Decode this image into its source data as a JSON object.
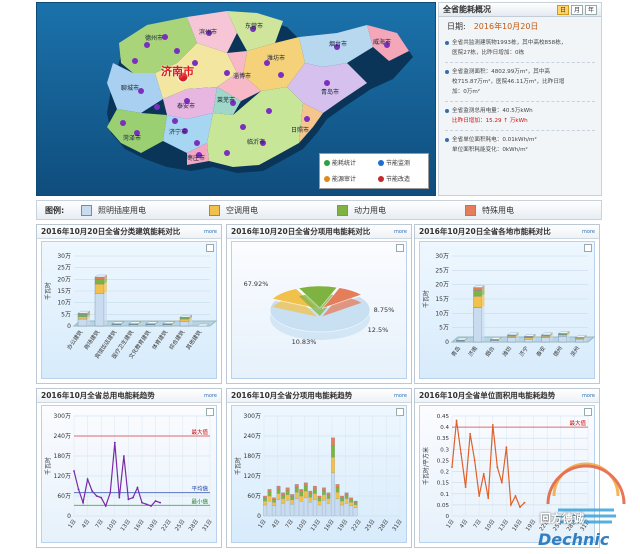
{
  "map": {
    "city_labels": [
      "济南市",
      "德州市",
      "滨州市",
      "东营市",
      "潍坊市",
      "烟台市",
      "威海市",
      "聊城市",
      "泰安市",
      "莱芜市",
      "淄博市",
      "青岛市",
      "日照市",
      "临沂市",
      "济宁市",
      "菏泽市",
      "枣庄市"
    ],
    "legend": [
      {
        "label": "能耗统计",
        "color": "#27a342"
      },
      {
        "label": "节能监测",
        "color": "#1d6fd1"
      },
      {
        "label": "能源审计",
        "color": "#e08a1a"
      },
      {
        "label": "节能改造",
        "color": "#c52a2a"
      }
    ]
  },
  "info": {
    "title": "全省能耗概况",
    "buttons": [
      "日",
      "月",
      "年"
    ],
    "date_label": "日期:",
    "date_value": "2016年10月20日",
    "blocks": [
      [
        "全省共监测建筑物1993栋，其中高校858栋，",
        "医院27栋，比昨日增加：0栋"
      ],
      [
        "全省监测面积：4802.99万m²，其中高",
        "校715.87万m²，医院46.11万m²，比昨日增",
        "加：0万m²"
      ],
      [
        "全省监测总用电量：40.5万kWh",
        "比昨日增加：15.29 ↑ 万kWh"
      ],
      [
        "全省单位面积耗电：0.01kWh/m²",
        "单位面积耗能变化：0kWh/m²"
      ]
    ]
  },
  "category_bar": {
    "title": "图例:",
    "items": [
      {
        "label": "照明插座用电",
        "color": "#c9dcef"
      },
      {
        "label": "空调用电",
        "color": "#f2c14b"
      },
      {
        "label": "动力用电",
        "color": "#7fb341"
      },
      {
        "label": "特殊用电",
        "color": "#e47d5a"
      }
    ]
  },
  "panels": [
    {
      "title": "2016年10月20日全省分类建筑能耗对比",
      "more": "more"
    },
    {
      "title": "2016年10月20日全省分项用电能耗对比",
      "more": "more"
    },
    {
      "title": "2016年10月20日全省各地市能耗对比",
      "more": "more"
    },
    {
      "title": "2016年10月全省总用电能耗趋势",
      "more": "more"
    },
    {
      "title": "2016年10月全省分项用电能耗趋势",
      "more": "more"
    },
    {
      "title": "2016年10月全省单位面积用电能耗趋势",
      "more": "more"
    }
  ],
  "chart_data": [
    {
      "type": "bar",
      "ylabel": "千瓦时",
      "yticks": [
        "30万",
        "25万",
        "20万",
        "15万",
        "10万",
        "5万",
        "0"
      ],
      "categories": [
        "办公建筑",
        "商场建筑",
        "宾馆饭店建筑",
        "医疗卫生建筑",
        "文化教育建筑",
        "体育建筑",
        "综合建筑",
        "其他建筑"
      ],
      "series": [
        {
          "values": [
            3,
            14,
            0.5,
            0.5,
            0.5,
            0.5,
            2,
            0
          ]
        },
        {
          "values": [
            1,
            4,
            0.2,
            0.2,
            0.2,
            0.2,
            1,
            0
          ]
        },
        {
          "values": [
            1,
            2,
            0.2,
            0.2,
            0.2,
            0.2,
            0.5,
            0
          ]
        },
        {
          "values": [
            0.5,
            1,
            0.1,
            0.1,
            0.1,
            0.1,
            0.3,
            0
          ]
        }
      ]
    },
    {
      "type": "pie",
      "slices": [
        {
          "label": "67.92%",
          "value": 67.92,
          "color": "#c9e0f3"
        },
        {
          "label": "10.83%",
          "value": 10.83,
          "color": "#f2c14b"
        },
        {
          "label": "12.5%",
          "value": 12.5,
          "color": "#7fb341"
        },
        {
          "label": "8.75%",
          "value": 8.75,
          "color": "#e47d5a"
        }
      ]
    },
    {
      "type": "bar",
      "ylabel": "千瓦时",
      "yticks": [
        "30万",
        "25万",
        "20万",
        "15万",
        "10万",
        "5万",
        "0"
      ],
      "categories": [
        "青岛",
        "济南",
        "烟台",
        "潍坊",
        "济宁",
        "泰安",
        "德州",
        "滨州"
      ],
      "series": [
        {
          "values": [
            0.3,
            12,
            0.5,
            1.5,
            1,
            1.5,
            2,
            1
          ]
        },
        {
          "values": [
            0.2,
            4,
            0.2,
            0.5,
            0.5,
            0.5,
            0.5,
            0.3
          ]
        },
        {
          "values": [
            0.1,
            2,
            0.1,
            0.3,
            0.3,
            0.3,
            0.3,
            0.2
          ]
        },
        {
          "values": [
            0.1,
            1,
            0.1,
            0.2,
            0.2,
            0.2,
            0.2,
            0.1
          ]
        }
      ]
    },
    {
      "type": "line",
      "ylabel": "千瓦时",
      "yticks": [
        "300万",
        "240万",
        "180万",
        "120万",
        "60万",
        "0"
      ],
      "ylim": [
        0,
        300
      ],
      "xticks": [
        "1日",
        "4日",
        "7日",
        "10日",
        "13日",
        "16日",
        "19日",
        "22日",
        "25日",
        "28日",
        "31日"
      ],
      "max_label": "最大值",
      "avg_label": "平均值",
      "min_label": "最小值",
      "max_value": 240,
      "avg_value": 70,
      "min_value": 32,
      "values": [
        135,
        80,
        40,
        110,
        75,
        60,
        55,
        30,
        70,
        220,
        55,
        180,
        50,
        55,
        85,
        40,
        35,
        30,
        45,
        40
      ]
    },
    {
      "type": "bar",
      "ylabel": "千瓦时",
      "yticks": [
        "300万",
        "240万",
        "180万",
        "120万",
        "60万",
        "0"
      ],
      "ylim": [
        0,
        300
      ],
      "xticks": [
        "1日",
        "4日",
        "7日",
        "10日",
        "13日",
        "16日",
        "19日",
        "22日",
        "25日",
        "28日",
        "31日"
      ],
      "values": [
        60,
        80,
        55,
        90,
        70,
        85,
        65,
        95,
        80,
        100,
        75,
        90,
        60,
        85,
        70,
        235,
        95,
        60,
        70,
        55,
        45
      ]
    },
    {
      "type": "line",
      "ylabel": "千瓦时/平方米",
      "yticks": [
        "0.45",
        "0.4",
        "0.35",
        "0.3",
        "0.25",
        "0.2",
        "0.15",
        "0.1",
        "0.05",
        "0"
      ],
      "ylim": [
        0,
        0.45
      ],
      "xticks": [
        "1日",
        "4日",
        "7日",
        "10日",
        "13日",
        "16日",
        "19日",
        "22日",
        "25日",
        "28日",
        "31日"
      ],
      "max_label": "最大值",
      "max_value": 0.4,
      "values": [
        0.22,
        0.43,
        0.28,
        0.13,
        0.37,
        0.25,
        0.09,
        0.19,
        0.08,
        0.41,
        0.22,
        0.15,
        0.31,
        0.05,
        0.09,
        0.04,
        0.06
      ]
    }
  ],
  "watermark": {
    "text": "Dechnic",
    "sub": "回方德诚"
  }
}
